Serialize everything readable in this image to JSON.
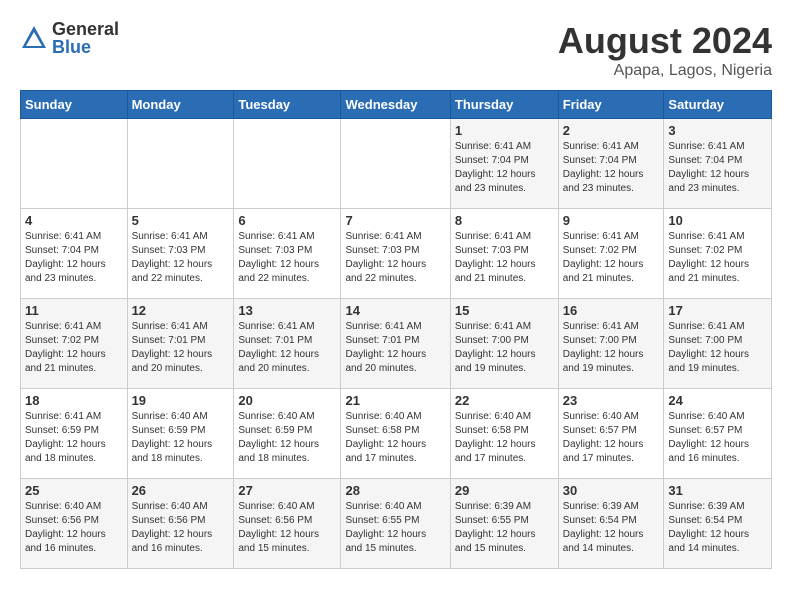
{
  "logo": {
    "general": "General",
    "blue": "Blue"
  },
  "title": {
    "month_year": "August 2024",
    "location": "Apapa, Lagos, Nigeria"
  },
  "headers": [
    "Sunday",
    "Monday",
    "Tuesday",
    "Wednesday",
    "Thursday",
    "Friday",
    "Saturday"
  ],
  "weeks": [
    [
      {
        "day": "",
        "info": ""
      },
      {
        "day": "",
        "info": ""
      },
      {
        "day": "",
        "info": ""
      },
      {
        "day": "",
        "info": ""
      },
      {
        "day": "1",
        "info": "Sunrise: 6:41 AM\nSunset: 7:04 PM\nDaylight: 12 hours\nand 23 minutes."
      },
      {
        "day": "2",
        "info": "Sunrise: 6:41 AM\nSunset: 7:04 PM\nDaylight: 12 hours\nand 23 minutes."
      },
      {
        "day": "3",
        "info": "Sunrise: 6:41 AM\nSunset: 7:04 PM\nDaylight: 12 hours\nand 23 minutes."
      }
    ],
    [
      {
        "day": "4",
        "info": "Sunrise: 6:41 AM\nSunset: 7:04 PM\nDaylight: 12 hours\nand 23 minutes."
      },
      {
        "day": "5",
        "info": "Sunrise: 6:41 AM\nSunset: 7:03 PM\nDaylight: 12 hours\nand 22 minutes."
      },
      {
        "day": "6",
        "info": "Sunrise: 6:41 AM\nSunset: 7:03 PM\nDaylight: 12 hours\nand 22 minutes."
      },
      {
        "day": "7",
        "info": "Sunrise: 6:41 AM\nSunset: 7:03 PM\nDaylight: 12 hours\nand 22 minutes."
      },
      {
        "day": "8",
        "info": "Sunrise: 6:41 AM\nSunset: 7:03 PM\nDaylight: 12 hours\nand 21 minutes."
      },
      {
        "day": "9",
        "info": "Sunrise: 6:41 AM\nSunset: 7:02 PM\nDaylight: 12 hours\nand 21 minutes."
      },
      {
        "day": "10",
        "info": "Sunrise: 6:41 AM\nSunset: 7:02 PM\nDaylight: 12 hours\nand 21 minutes."
      }
    ],
    [
      {
        "day": "11",
        "info": "Sunrise: 6:41 AM\nSunset: 7:02 PM\nDaylight: 12 hours\nand 21 minutes."
      },
      {
        "day": "12",
        "info": "Sunrise: 6:41 AM\nSunset: 7:01 PM\nDaylight: 12 hours\nand 20 minutes."
      },
      {
        "day": "13",
        "info": "Sunrise: 6:41 AM\nSunset: 7:01 PM\nDaylight: 12 hours\nand 20 minutes."
      },
      {
        "day": "14",
        "info": "Sunrise: 6:41 AM\nSunset: 7:01 PM\nDaylight: 12 hours\nand 20 minutes."
      },
      {
        "day": "15",
        "info": "Sunrise: 6:41 AM\nSunset: 7:00 PM\nDaylight: 12 hours\nand 19 minutes."
      },
      {
        "day": "16",
        "info": "Sunrise: 6:41 AM\nSunset: 7:00 PM\nDaylight: 12 hours\nand 19 minutes."
      },
      {
        "day": "17",
        "info": "Sunrise: 6:41 AM\nSunset: 7:00 PM\nDaylight: 12 hours\nand 19 minutes."
      }
    ],
    [
      {
        "day": "18",
        "info": "Sunrise: 6:41 AM\nSunset: 6:59 PM\nDaylight: 12 hours\nand 18 minutes."
      },
      {
        "day": "19",
        "info": "Sunrise: 6:40 AM\nSunset: 6:59 PM\nDaylight: 12 hours\nand 18 minutes."
      },
      {
        "day": "20",
        "info": "Sunrise: 6:40 AM\nSunset: 6:59 PM\nDaylight: 12 hours\nand 18 minutes."
      },
      {
        "day": "21",
        "info": "Sunrise: 6:40 AM\nSunset: 6:58 PM\nDaylight: 12 hours\nand 17 minutes."
      },
      {
        "day": "22",
        "info": "Sunrise: 6:40 AM\nSunset: 6:58 PM\nDaylight: 12 hours\nand 17 minutes."
      },
      {
        "day": "23",
        "info": "Sunrise: 6:40 AM\nSunset: 6:57 PM\nDaylight: 12 hours\nand 17 minutes."
      },
      {
        "day": "24",
        "info": "Sunrise: 6:40 AM\nSunset: 6:57 PM\nDaylight: 12 hours\nand 16 minutes."
      }
    ],
    [
      {
        "day": "25",
        "info": "Sunrise: 6:40 AM\nSunset: 6:56 PM\nDaylight: 12 hours\nand 16 minutes."
      },
      {
        "day": "26",
        "info": "Sunrise: 6:40 AM\nSunset: 6:56 PM\nDaylight: 12 hours\nand 16 minutes."
      },
      {
        "day": "27",
        "info": "Sunrise: 6:40 AM\nSunset: 6:56 PM\nDaylight: 12 hours\nand 15 minutes."
      },
      {
        "day": "28",
        "info": "Sunrise: 6:40 AM\nSunset: 6:55 PM\nDaylight: 12 hours\nand 15 minutes."
      },
      {
        "day": "29",
        "info": "Sunrise: 6:39 AM\nSunset: 6:55 PM\nDaylight: 12 hours\nand 15 minutes."
      },
      {
        "day": "30",
        "info": "Sunrise: 6:39 AM\nSunset: 6:54 PM\nDaylight: 12 hours\nand 14 minutes."
      },
      {
        "day": "31",
        "info": "Sunrise: 6:39 AM\nSunset: 6:54 PM\nDaylight: 12 hours\nand 14 minutes."
      }
    ]
  ]
}
